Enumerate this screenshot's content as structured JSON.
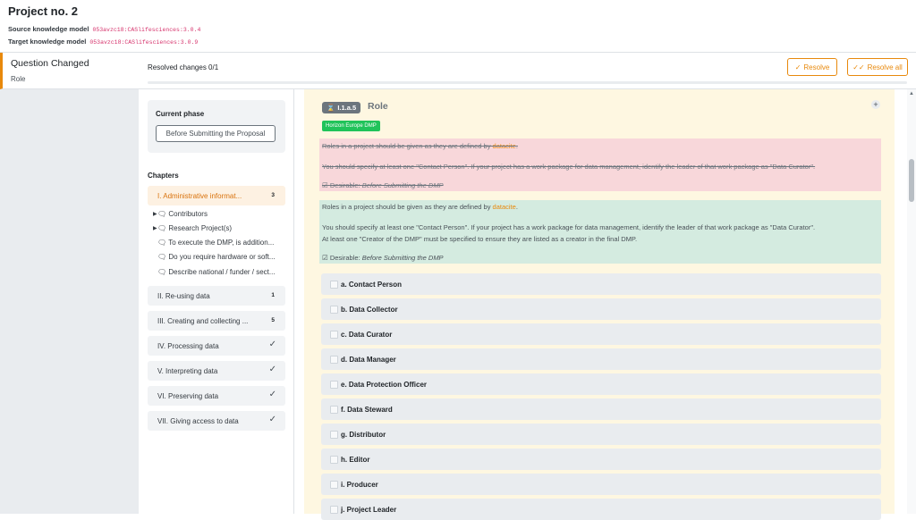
{
  "header": {
    "title": "Project no. 2",
    "source_label": "Source knowledge model",
    "source_value": "053avzc18:CASlifesciences:3.0.4",
    "target_label": "Target knowledge model",
    "target_value": "053avzc18:CASlifesciences:3.0.9"
  },
  "left": {
    "item_title": "Question Changed",
    "item_subtitle": "Role"
  },
  "resolve_bar": {
    "status": "Resolved changes 0/1",
    "progress": 0,
    "resolve_label": "Resolve",
    "resolve_all_label": "Resolve all"
  },
  "sidebar": {
    "phase_label": "Current phase",
    "phase_value": "Before Submitting the Proposal",
    "chapters_label": "Chapters",
    "chapters": [
      {
        "label": "I. Administrative informat...",
        "count": "3",
        "active": true
      },
      {
        "label": "II. Re-using data",
        "count": "1"
      },
      {
        "label": "III. Creating and collecting ...",
        "count": "5"
      },
      {
        "label": "IV. Processing data",
        "done": true
      },
      {
        "label": "V. Interpreting data",
        "done": true
      },
      {
        "label": "VI. Preserving data",
        "done": true
      },
      {
        "label": "VII. Giving access to data",
        "done": true
      }
    ],
    "questions": [
      "Contributors",
      "Research Project(s)",
      "To execute the DMP, is addition...",
      "Do you require hardware or soft...",
      "Describe national / funder / sect..."
    ]
  },
  "question": {
    "code": "I.1.a.5",
    "title": "Role",
    "tag": "Horizon Europe DMP",
    "old_line1_a": "Roles in a project should be given as they are defined by ",
    "old_line1_link": "datacite",
    "old_line1_b": ".",
    "old_line2": "You should specify at least one \"Contact Person\". If your project has a work package for data management, identify the leader of that work package as \"Data Curator\".",
    "old_desirable_a": "Desirable: ",
    "old_desirable_b": "Before Submitting the DMP",
    "new_line1_a": "Roles in a project should be given as they are defined by ",
    "new_line1_link": "datacite",
    "new_line1_b": ".",
    "new_line2": "You should specify at least one \"Contact Person\". If your project has a work package for data management, identify the leader of that work package as \"Data Curator\".",
    "new_line3": "At least one \"Creator of the DMP\" must be specified to ensure they are listed as a creator in the final DMP.",
    "new_desirable_a": "Desirable: ",
    "new_desirable_b": "Before Submitting the DMP",
    "options": [
      "a. Contact Person",
      "b. Data Collector",
      "c. Data Curator",
      "d. Data Manager",
      "e. Data Protection Officer",
      "f. Data Steward",
      "g. Distributor",
      "h. Editor",
      "i. Producer",
      "j. Project Leader"
    ]
  },
  "colors": {
    "accent": "#e8890c",
    "removed": "#f8d7da",
    "added": "#d4ebe0",
    "tag": "#20c35a"
  }
}
